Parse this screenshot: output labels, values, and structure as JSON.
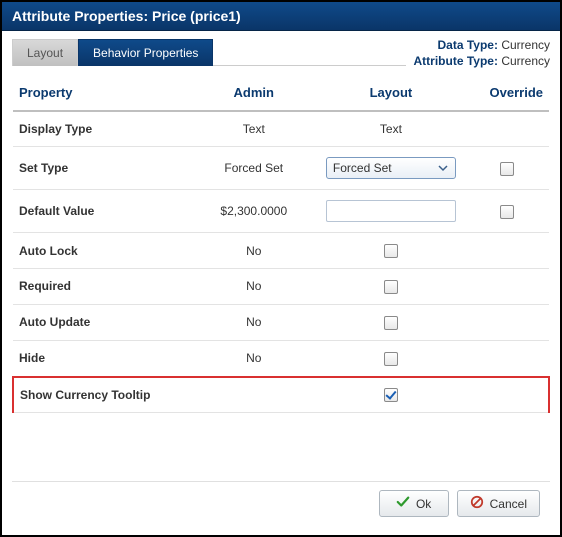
{
  "header": {
    "title": "Attribute Properties: Price (price1)"
  },
  "meta": {
    "data_type_label": "Data Type:",
    "data_type_value": "Currency",
    "attr_type_label": "Attribute Type:",
    "attr_type_value": "Currency"
  },
  "tabs": {
    "layout": "Layout",
    "behavior": "Behavior Properties"
  },
  "columns": {
    "property": "Property",
    "admin": "Admin",
    "layout": "Layout",
    "override": "Override"
  },
  "rows": {
    "display_type": {
      "label": "Display Type",
      "admin": "Text",
      "layout_text": "Text"
    },
    "set_type": {
      "label": "Set Type",
      "admin": "Forced Set",
      "layout_select": "Forced Set"
    },
    "default_value": {
      "label": "Default Value",
      "admin": "$2,300.0000",
      "layout_input": ""
    },
    "auto_lock": {
      "label": "Auto Lock",
      "admin": "No"
    },
    "required": {
      "label": "Required",
      "admin": "No"
    },
    "auto_update": {
      "label": "Auto Update",
      "admin": "No"
    },
    "hide": {
      "label": "Hide",
      "admin": "No"
    },
    "show_tooltip": {
      "label": "Show Currency Tooltip"
    }
  },
  "buttons": {
    "ok": "Ok",
    "cancel": "Cancel"
  }
}
